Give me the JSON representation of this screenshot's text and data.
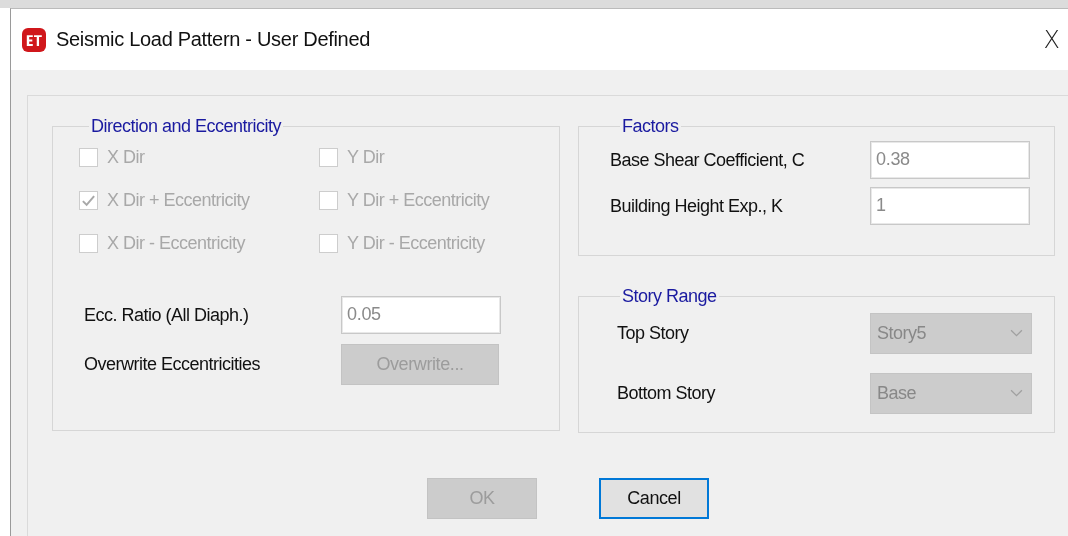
{
  "window": {
    "title": "Seismic Load Pattern - User Defined",
    "close": "X"
  },
  "direction_and_eccentricity": {
    "title": "Direction and Eccentricity",
    "checkboxes": [
      {
        "label": "X Dir",
        "checked": false,
        "disabled": true
      },
      {
        "label": "Y Dir",
        "checked": false,
        "disabled": true
      },
      {
        "label": "X Dir + Eccentricity",
        "checked": true,
        "disabled": true
      },
      {
        "label": "Y Dir + Eccentricity",
        "checked": false,
        "disabled": true
      },
      {
        "label": "X Dir - Eccentricity",
        "checked": false,
        "disabled": true
      },
      {
        "label": "Y Dir - Eccentricity",
        "checked": false,
        "disabled": true
      }
    ],
    "ecc_ratio": {
      "label": "Ecc. Ratio (All Diaph.)",
      "value": "0.05",
      "disabled": true
    },
    "overwrite": {
      "label": "Overwrite Eccentricities",
      "button": "Overwrite...",
      "disabled": true
    }
  },
  "factors": {
    "title": "Factors",
    "fields": [
      {
        "label": "Base Shear Coefficient, C",
        "value": "0.38",
        "disabled": true
      },
      {
        "label": "Building Height Exp., K",
        "value": "1",
        "disabled": true
      }
    ]
  },
  "story_range": {
    "title": "Story Range",
    "dropdowns": [
      {
        "label": "Top Story",
        "value": "Story5",
        "disabled": true
      },
      {
        "label": "Bottom Story",
        "value": "Base",
        "disabled": true
      }
    ]
  },
  "buttons": [
    {
      "label": "OK",
      "disabled": true,
      "focused": false
    },
    {
      "label": "Cancel",
      "disabled": false,
      "focused": true
    }
  ]
}
